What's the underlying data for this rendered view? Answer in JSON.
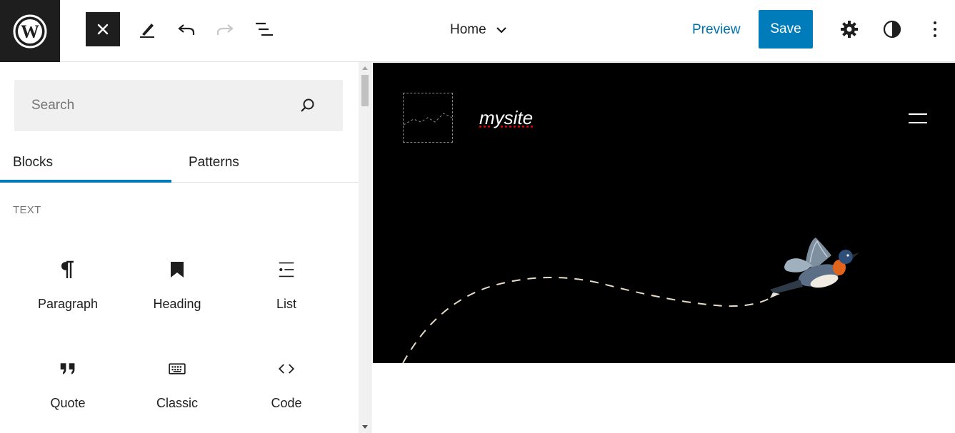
{
  "toolbar": {
    "logo_icon": "wordpress-logo-icon",
    "close_icon": "close-icon",
    "tools": [
      "edit-pencil-icon",
      "undo-icon",
      "redo-icon",
      "list-view-icon"
    ],
    "document_title": "Home",
    "preview_label": "Preview",
    "save_label": "Save",
    "settings_icon": "gear-icon",
    "styles_icon": "contrast-icon",
    "more_icon": "more-vertical-icon"
  },
  "sidebar": {
    "search_placeholder": "Search",
    "tabs": [
      {
        "label": "Blocks",
        "active": true
      },
      {
        "label": "Patterns",
        "active": false
      }
    ],
    "category": "TEXT",
    "blocks": [
      {
        "label": "Paragraph",
        "icon": "paragraph-icon"
      },
      {
        "label": "Heading",
        "icon": "bookmark-icon"
      },
      {
        "label": "List",
        "icon": "list-icon"
      },
      {
        "label": "Quote",
        "icon": "quote-icon"
      },
      {
        "label": "Classic",
        "icon": "keyboard-icon"
      },
      {
        "label": "Code",
        "icon": "code-icon"
      }
    ]
  },
  "canvas": {
    "site_title": "mysite",
    "hero_bg": "#000000",
    "illustration": "bird-illustration"
  },
  "colors": {
    "accent": "#007cba",
    "link": "#0073aa",
    "dark": "#1e1e1e"
  }
}
